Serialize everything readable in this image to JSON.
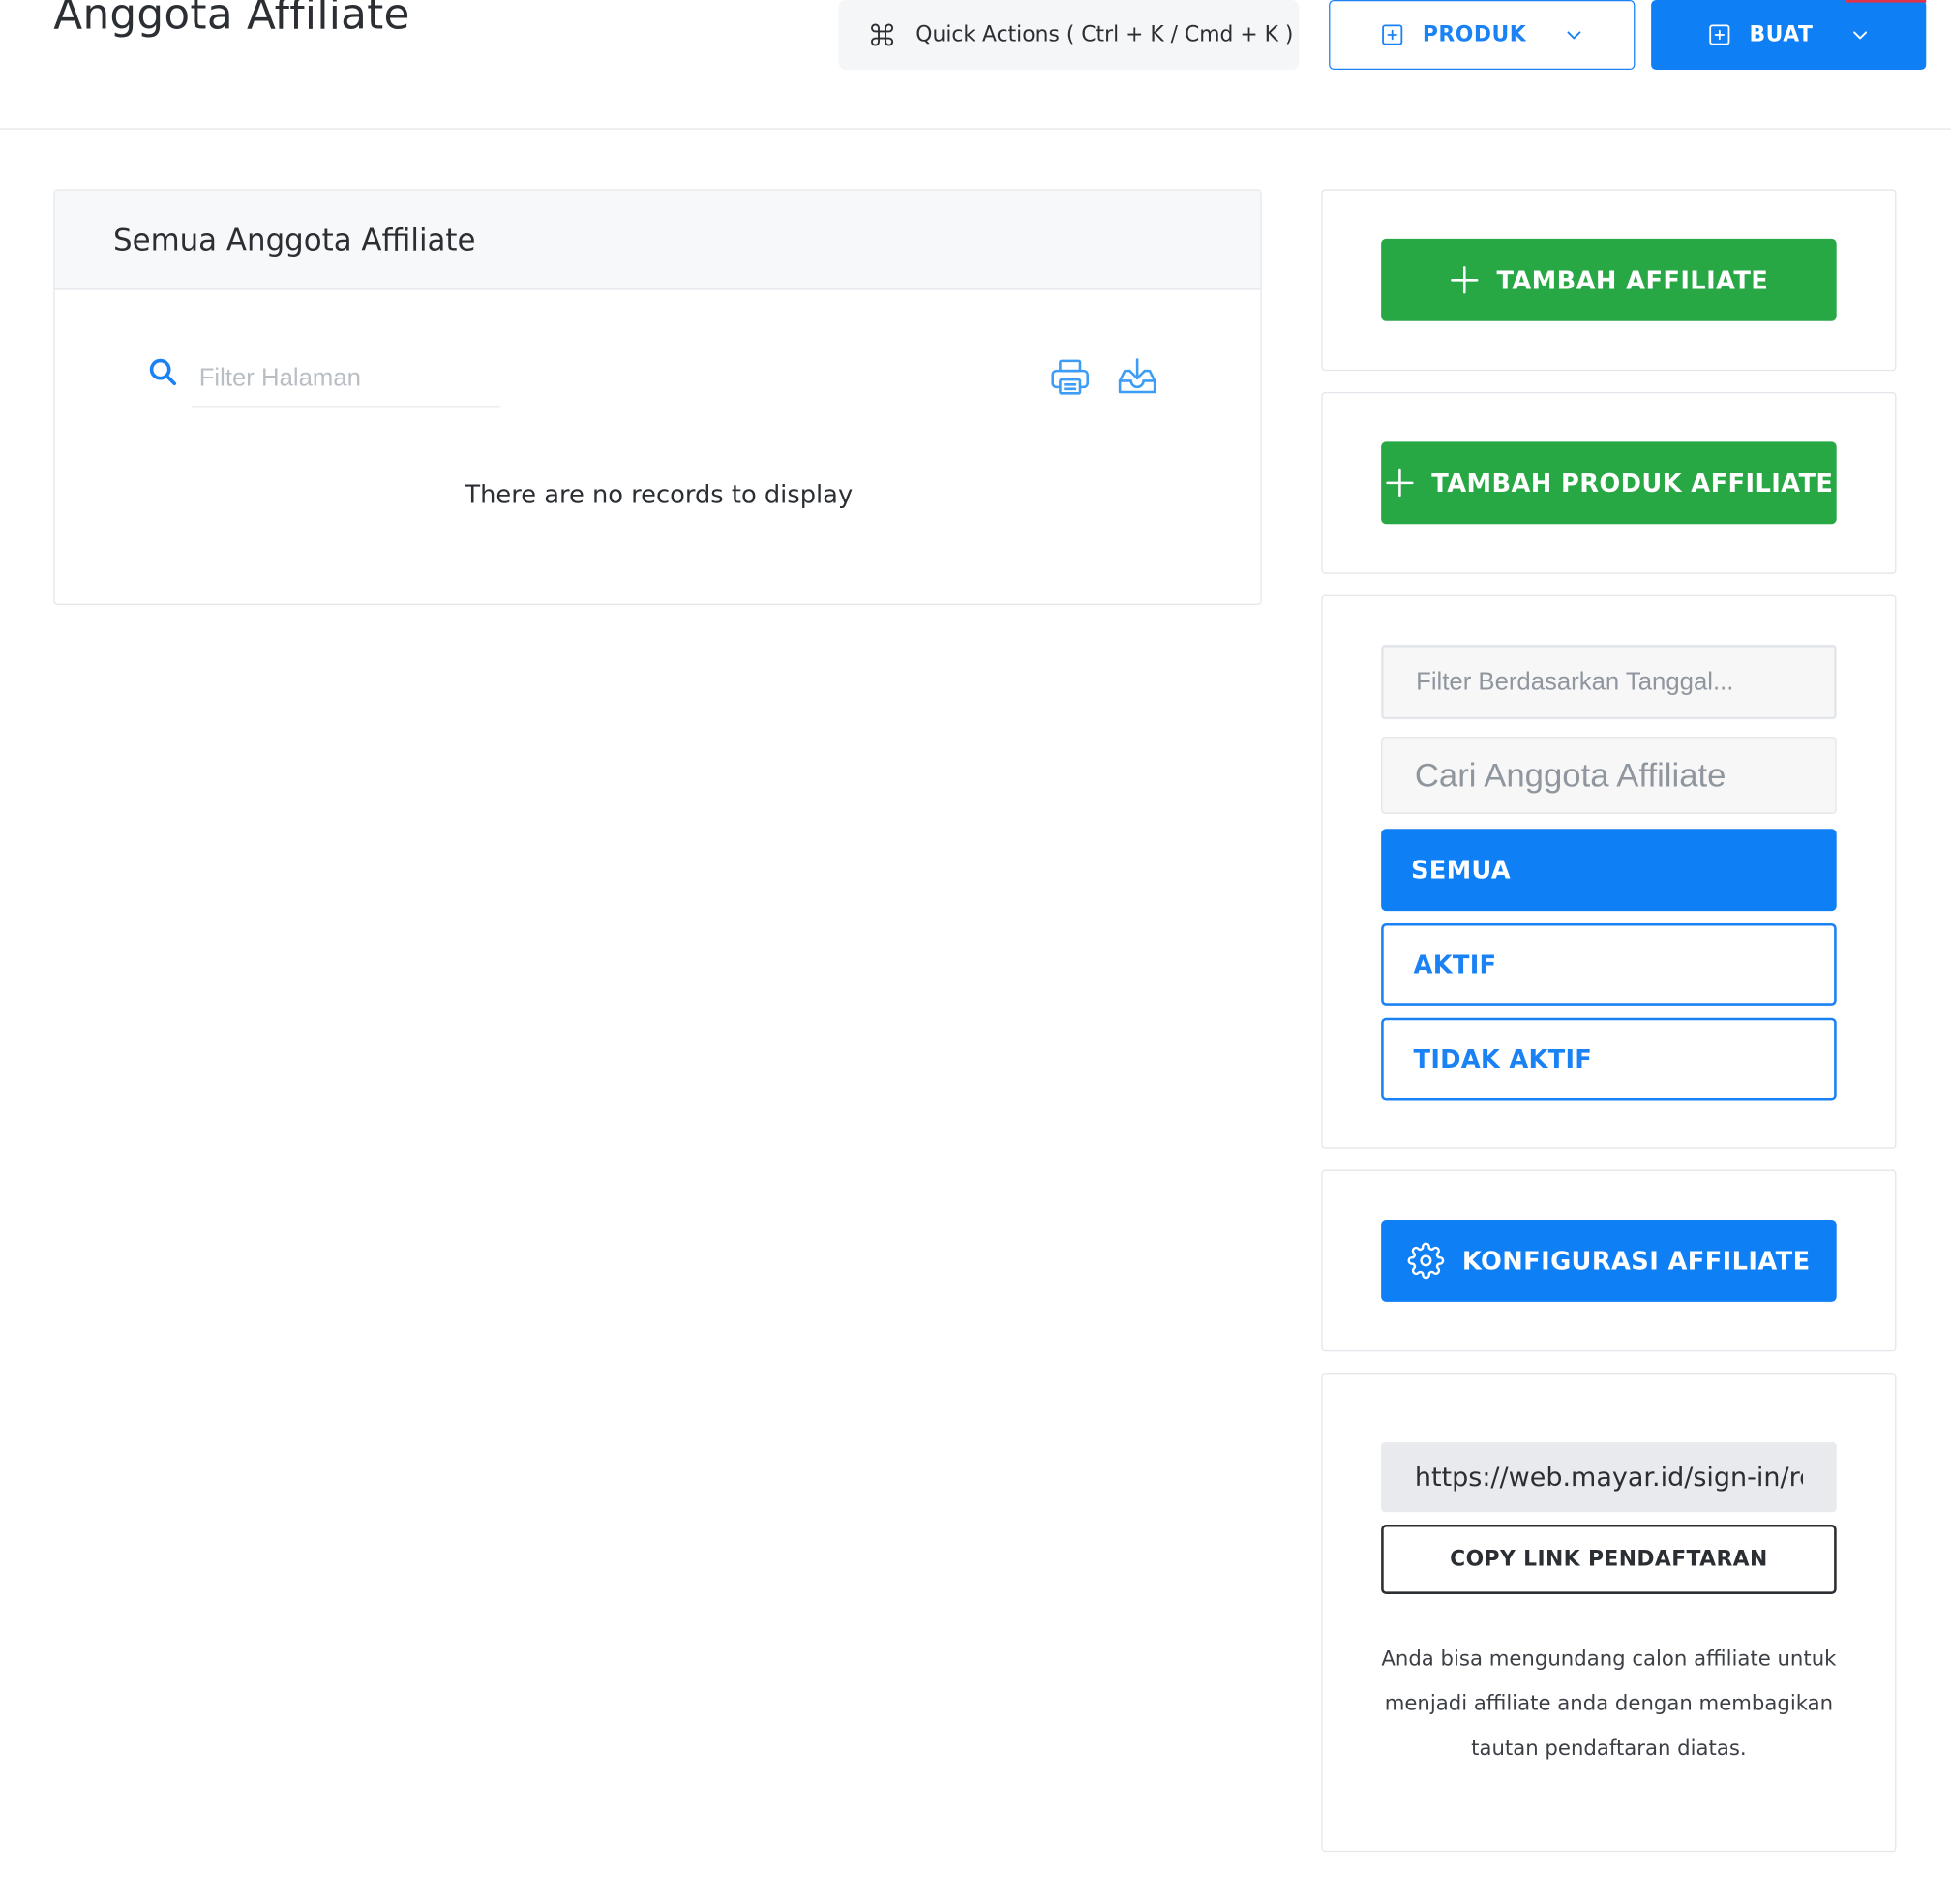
{
  "header": {
    "title": "Anggota Affiliate",
    "quick_actions_label": "Quick Actions ( Ctrl + K / Cmd + K )",
    "produk_label": "PRODUK",
    "buat_label": "BUAT"
  },
  "main": {
    "card_title": "Semua Anggota Affiliate",
    "search_placeholder": "Filter Halaman",
    "empty_message": "There are no records to display"
  },
  "sidebar": {
    "add_affiliate_label": "TAMBAH AFFILIATE",
    "add_product_affiliate_label": "TAMBAH PRODUK AFFILIATE",
    "date_filter_placeholder": "Filter Berdasarkan Tanggal...",
    "member_search_placeholder": "Cari Anggota Affiliate",
    "filters": [
      {
        "label": "SEMUA",
        "active": true
      },
      {
        "label": "AKTIF",
        "active": false
      },
      {
        "label": "TIDAK AKTIF",
        "active": false
      }
    ],
    "config_label": "KONFIGURASI AFFILIATE",
    "referral_link": "https://web.mayar.id/sign-in/refe",
    "copy_link_label": "COPY LINK PENDAFTARAN",
    "help_text": "Anda bisa mengundang calon affiliate untuk menjadi affiliate anda dengan membagikan tautan pendaftaran diatas."
  },
  "colors": {
    "primary": "#0f7ff5",
    "success": "#28a745",
    "text": "#2b2f33",
    "border": "#e3e6ea"
  },
  "icons": [
    "command-icon",
    "plus-square-icon",
    "chevron-down-icon",
    "search-icon",
    "printer-icon",
    "download-inbox-icon",
    "plus-icon",
    "gear-icon"
  ]
}
